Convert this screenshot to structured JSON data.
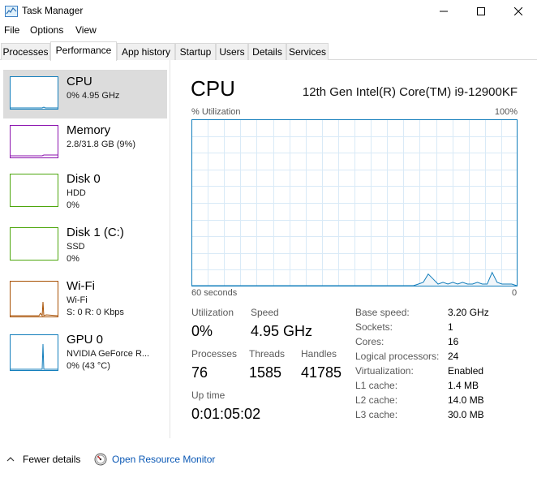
{
  "window": {
    "title": "Task Manager"
  },
  "menu": [
    "File",
    "Options",
    "View"
  ],
  "tabs": [
    {
      "label": "Processes"
    },
    {
      "label": "Performance"
    },
    {
      "label": "App history"
    },
    {
      "label": "Startup"
    },
    {
      "label": "Users"
    },
    {
      "label": "Details"
    },
    {
      "label": "Services"
    }
  ],
  "active_tab": "Performance",
  "sidebar": [
    {
      "name": "CPU",
      "line1": "0%  4.95 GHz",
      "line2": "",
      "color": "#117dbb",
      "selected": true
    },
    {
      "name": "Memory",
      "line1": "2.8/31.8 GB (9%)",
      "line2": "",
      "color": "#8b12ae",
      "selected": false
    },
    {
      "name": "Disk 0",
      "line1": "HDD",
      "line2": "0%",
      "color": "#4da60c",
      "selected": false
    },
    {
      "name": "Disk 1 (C:)",
      "line1": "SSD",
      "line2": "0%",
      "color": "#4da60c",
      "selected": false
    },
    {
      "name": "Wi-Fi",
      "line1": "Wi-Fi",
      "line2": "S: 0  R: 0 Kbps",
      "color": "#a74f01",
      "selected": false
    },
    {
      "name": "GPU 0",
      "line1": "NVIDIA GeForce R...",
      "line2": "0%  (43 °C)",
      "color": "#117dbb",
      "selected": false
    }
  ],
  "main": {
    "title": "CPU",
    "model": "12th Gen Intel(R) Core(TM) i9-12900KF",
    "graph_label": "% Utilization",
    "graph_max": "100%",
    "axis_left": "60 seconds",
    "axis_right": "0",
    "graph_color": "#117dbb",
    "graph_series": [
      0,
      0,
      0,
      0,
      0,
      0,
      0,
      0,
      0,
      0,
      0,
      0,
      0,
      0,
      0,
      0,
      0,
      0,
      0,
      0,
      0,
      0,
      0,
      0,
      0,
      0,
      0,
      0,
      0,
      0,
      0,
      0,
      0,
      0,
      0,
      0,
      0,
      0,
      0,
      0,
      0,
      0,
      0,
      0,
      0,
      0,
      1,
      2,
      7,
      4,
      1,
      2,
      1,
      2,
      1,
      2,
      1,
      1,
      2,
      1,
      1,
      8,
      2,
      1,
      1,
      1,
      0
    ],
    "stats": {
      "utilization_label": "Utilization",
      "utilization": "0%",
      "speed_label": "Speed",
      "speed": "4.95 GHz",
      "processes_label": "Processes",
      "processes": "76",
      "threads_label": "Threads",
      "threads": "1585",
      "handles_label": "Handles",
      "handles": "41785",
      "uptime_label": "Up time",
      "uptime": "0:01:05:02"
    },
    "specs": [
      {
        "key": "Base speed:",
        "value": "3.20 GHz"
      },
      {
        "key": "Sockets:",
        "value": "1"
      },
      {
        "key": "Cores:",
        "value": "16"
      },
      {
        "key": "Logical processors:",
        "value": "24"
      },
      {
        "key": "Virtualization:",
        "value": "Enabled"
      },
      {
        "key": "L1 cache:",
        "value": "1.4 MB"
      },
      {
        "key": "L2 cache:",
        "value": "14.0 MB"
      },
      {
        "key": "L3 cache:",
        "value": "30.0 MB"
      }
    ]
  },
  "footer": {
    "fewer_details": "Fewer details",
    "resource_monitor": "Open Resource Monitor"
  }
}
